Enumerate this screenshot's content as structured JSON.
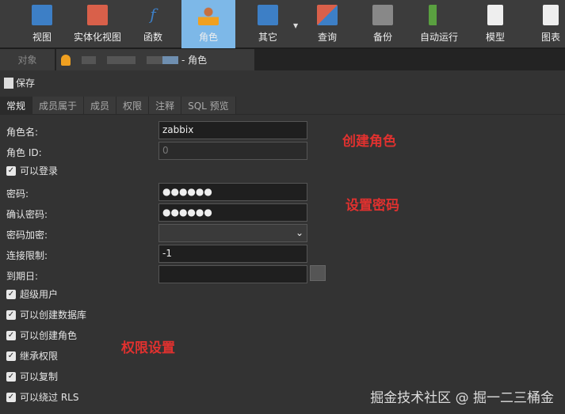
{
  "toolbar": {
    "items": [
      {
        "label": "视图",
        "icon": "view-icon",
        "color": "#3d7fc6"
      },
      {
        "label": "实体化视图",
        "icon": "materialized-view-icon",
        "color": "#d9604a"
      },
      {
        "label": "函数",
        "icon": "function-icon",
        "color": "#3d7fc6"
      },
      {
        "label": "角色",
        "icon": "role-icon",
        "color": "#f0a020"
      },
      {
        "label": "其它",
        "icon": "tools-icon",
        "color": "#3d7fc6"
      },
      {
        "label": "查询",
        "icon": "query-icon",
        "color": "#3d7fc6"
      },
      {
        "label": "备份",
        "icon": "backup-icon",
        "color": "#888888"
      },
      {
        "label": "自动运行",
        "icon": "automation-icon",
        "color": "#5aa040"
      },
      {
        "label": "模型",
        "icon": "model-icon",
        "color": "#eeeeee"
      },
      {
        "label": "图表",
        "icon": "chart-icon",
        "color": "#eeeeee"
      }
    ]
  },
  "tabbar": {
    "objects": "对象",
    "role_tab": "- 角色"
  },
  "save_label": "保存",
  "tabs": [
    "常规",
    "成员属于",
    "成员",
    "权限",
    "注释",
    "SQL 预览"
  ],
  "form": {
    "role_name_label": "角色名:",
    "role_name": "zabbix",
    "role_id_label": "角色 ID:",
    "role_id": "0",
    "can_login": "可以登录",
    "password_label": "密码:",
    "password": "●●●●●●",
    "confirm_label": "确认密码:",
    "confirm": "●●●●●●",
    "encrypt_label": "密码加密:",
    "conn_limit_label": "连接限制:",
    "conn_limit": "-1",
    "expiry_label": "到期日:"
  },
  "checks": [
    "超级用户",
    "可以创建数据库",
    "可以创建角色",
    "继承权限",
    "可以复制",
    "可以绕过 RLS"
  ],
  "annotations": {
    "create": "创建角色",
    "password": "设置密码",
    "perm": "权限设置"
  },
  "watermark": "掘金技术社区 @ 掘一二三桶金"
}
